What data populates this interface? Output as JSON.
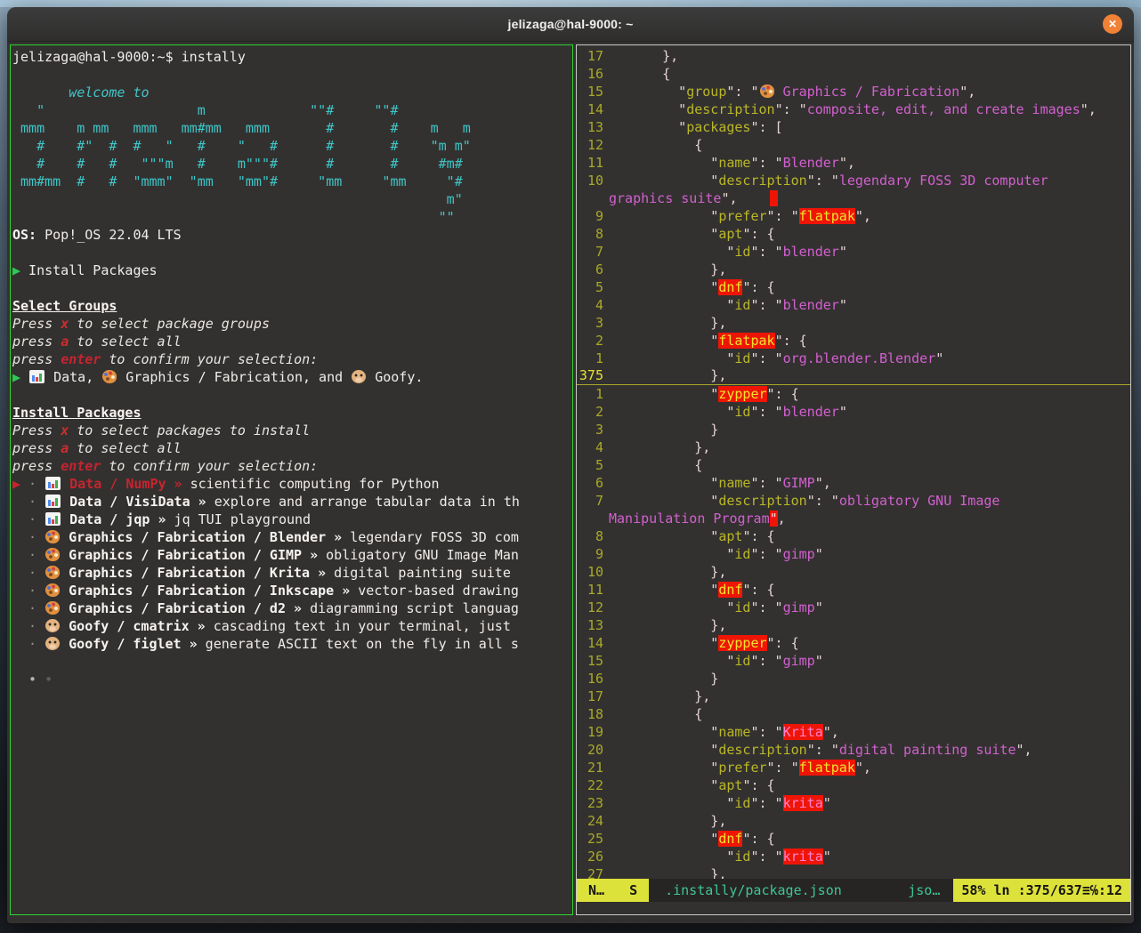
{
  "window": {
    "title": "jelizaga@hal-9000: ~",
    "close_label": "✕"
  },
  "accents": {
    "focused_pane_border": "#2fd32f",
    "unfocused_pane_border": "#c9c9c9",
    "search_highlight_bg": "#ee1507",
    "close_button": "#f08137",
    "statusline_yellow": "#dde23a",
    "terminal_bg": "#333130",
    "ascii_cyan": "#3fc6c8"
  },
  "left_pane": {
    "lines": [
      [
        [
          "w",
          "jelizaga@hal-9000:~$ instally"
        ]
      ],
      [],
      [
        [
          "ci",
          "       welcome to"
        ]
      ],
      [
        [
          "c",
          "   \"                   m             \"\"#     \"\"#"
        ]
      ],
      [
        [
          "c",
          " mmm    m mm   mmm   mm#mm   mmm       #       #    m   m"
        ]
      ],
      [
        [
          "c",
          "   #    #\"  #  #   \"   #    \"   #      #       #    \"m m\""
        ]
      ],
      [
        [
          "c",
          "   #    #   #   \"\"\"m   #    m\"\"\"#      #       #     #m#"
        ]
      ],
      [
        [
          "c",
          " mm#mm  #   #  \"mmm\"  \"mm   \"mm\"#     \"mm     \"mm     \"#"
        ]
      ],
      [
        [
          "c",
          "                                                      m\""
        ]
      ],
      [
        [
          "c",
          "                                                     \"\""
        ]
      ],
      [
        [
          "b",
          "OS:"
        ],
        [
          "w",
          " Pop!_OS 22.04 LTS"
        ]
      ],
      [],
      [
        [
          "g",
          "▶"
        ],
        [
          "w",
          " Install Packages"
        ]
      ],
      [],
      [
        [
          "bu",
          "Select Groups"
        ]
      ],
      [
        [
          "i",
          "Press "
        ],
        [
          "x",
          "x"
        ],
        [
          "i",
          " to select package groups"
        ]
      ],
      [
        [
          "i",
          "press "
        ],
        [
          "x",
          "a"
        ],
        [
          "i",
          " to select all"
        ]
      ],
      [
        [
          "i",
          "press "
        ],
        [
          "eb",
          "enter"
        ],
        [
          "i",
          " to confirm your selection:"
        ]
      ],
      [
        [
          "g",
          "▶"
        ],
        [
          "w",
          " "
        ],
        [
          "icoData",
          ""
        ],
        [
          "w",
          " Data, "
        ],
        [
          "icoGfx",
          ""
        ],
        [
          "w",
          " Graphics / Fabrication, and "
        ],
        [
          "icoGoofy",
          ""
        ],
        [
          "w",
          " Goofy."
        ]
      ],
      [],
      [
        [
          "bu",
          "Install Packages"
        ]
      ],
      [
        [
          "i",
          "Press "
        ],
        [
          "x",
          "x"
        ],
        [
          "i",
          " to select packages to install"
        ]
      ],
      [
        [
          "i",
          "press "
        ],
        [
          "x",
          "a"
        ],
        [
          "i",
          " to select all"
        ]
      ],
      [
        [
          "i",
          "press "
        ],
        [
          "eb",
          "enter"
        ],
        [
          "i",
          " to confirm your selection:"
        ]
      ],
      [
        [
          "nr",
          "▶"
        ],
        [
          "dot",
          " · "
        ],
        [
          "icoData",
          ""
        ],
        [
          "nr",
          " Data / NumPy »"
        ],
        [
          "w",
          " scientific computing for Python"
        ]
      ],
      [
        [
          "dot",
          "  · "
        ],
        [
          "icoData",
          ""
        ],
        [
          "b",
          " Data / VisiData »"
        ],
        [
          "w",
          " explore and arrange tabular data in th"
        ]
      ],
      [
        [
          "dot",
          "  · "
        ],
        [
          "icoData",
          ""
        ],
        [
          "b",
          " Data / jqp »"
        ],
        [
          "w",
          " jq TUI playground"
        ]
      ],
      [
        [
          "dot",
          "  · "
        ],
        [
          "icoGfx",
          ""
        ],
        [
          "b",
          " Graphics / Fabrication / Blender »"
        ],
        [
          "w",
          " legendary FOSS 3D com"
        ]
      ],
      [
        [
          "dot",
          "  · "
        ],
        [
          "icoGfx",
          ""
        ],
        [
          "b",
          " Graphics / Fabrication / GIMP »"
        ],
        [
          "w",
          " obligatory GNU Image Man"
        ]
      ],
      [
        [
          "dot",
          "  · "
        ],
        [
          "icoGfx",
          ""
        ],
        [
          "b",
          " Graphics / Fabrication / Krita »"
        ],
        [
          "w",
          " digital painting suite"
        ]
      ],
      [
        [
          "dot",
          "  · "
        ],
        [
          "icoGfx",
          ""
        ],
        [
          "b",
          " Graphics / Fabrication / Inkscape »"
        ],
        [
          "w",
          " vector-based drawing"
        ]
      ],
      [
        [
          "dot",
          "  · "
        ],
        [
          "icoGfx",
          ""
        ],
        [
          "b",
          " Graphics / Fabrication / d2 »"
        ],
        [
          "w",
          " diagramming script languag"
        ]
      ],
      [
        [
          "dot",
          "  · "
        ],
        [
          "icoGoofy",
          ""
        ],
        [
          "b",
          " Goofy / cmatrix »"
        ],
        [
          "w",
          " cascading text in your terminal, just"
        ]
      ],
      [
        [
          "dot",
          "  · "
        ],
        [
          "icoGoofy",
          ""
        ],
        [
          "b",
          " Goofy / figlet »"
        ],
        [
          "w",
          " generate ASCII text on the fly in all s"
        ]
      ],
      [],
      [
        [
          "pga",
          "  •"
        ],
        [
          "pgb",
          " •"
        ]
      ]
    ]
  },
  "right_pane": {
    "lines": [
      {
        "n": "17",
        "seg": [
          [
            "p",
            "    },"
          ]
        ]
      },
      {
        "n": "16",
        "seg": [
          [
            "p",
            "    {"
          ]
        ]
      },
      {
        "n": "15",
        "seg": [
          [
            "p",
            "      \""
          ],
          [
            "k",
            "group"
          ],
          [
            "p",
            "\": \""
          ],
          [
            "icoGfx",
            ""
          ],
          [
            "v",
            " Graphics / Fabrication"
          ],
          [
            "p",
            "\","
          ]
        ]
      },
      {
        "n": "14",
        "seg": [
          [
            "p",
            "      \""
          ],
          [
            "k",
            "description"
          ],
          [
            "p",
            "\": \""
          ],
          [
            "v",
            "composite, edit, and create images"
          ],
          [
            "p",
            "\","
          ]
        ]
      },
      {
        "n": "13",
        "seg": [
          [
            "p",
            "      \""
          ],
          [
            "k",
            "packages"
          ],
          [
            "p",
            "\": ["
          ]
        ]
      },
      {
        "n": "12",
        "seg": [
          [
            "p",
            "        {"
          ]
        ]
      },
      {
        "n": "11",
        "seg": [
          [
            "p",
            "          \""
          ],
          [
            "k",
            "name"
          ],
          [
            "p",
            "\": \""
          ],
          [
            "v",
            "Blender"
          ],
          [
            "p",
            "\","
          ]
        ]
      },
      {
        "n": "10",
        "seg": [
          [
            "p",
            "          \""
          ],
          [
            "k",
            "description"
          ],
          [
            "p",
            "\": \""
          ],
          [
            "v",
            "legendary FOSS 3D computer"
          ]
        ]
      },
      {
        "n": "",
        "wrap": true,
        "seg": [
          [
            "v",
            "graphics suite"
          ],
          [
            "p",
            "\",    "
          ],
          [
            "blk",
            " "
          ]
        ]
      },
      {
        "n": "9",
        "seg": [
          [
            "p",
            "          \""
          ],
          [
            "k",
            "prefer"
          ],
          [
            "p",
            "\": \""
          ],
          [
            "hy",
            "flatpak"
          ],
          [
            "p",
            "\","
          ]
        ]
      },
      {
        "n": "8",
        "seg": [
          [
            "p",
            "          \""
          ],
          [
            "k",
            "apt"
          ],
          [
            "p",
            "\": {"
          ]
        ]
      },
      {
        "n": "7",
        "seg": [
          [
            "p",
            "            \""
          ],
          [
            "k",
            "id"
          ],
          [
            "p",
            "\": \""
          ],
          [
            "v",
            "blender"
          ],
          [
            "p",
            "\""
          ]
        ]
      },
      {
        "n": "6",
        "seg": [
          [
            "p",
            "          },"
          ]
        ]
      },
      {
        "n": "5",
        "seg": [
          [
            "p",
            "          \""
          ],
          [
            "hy",
            "dnf"
          ],
          [
            "p",
            "\": {"
          ]
        ]
      },
      {
        "n": "4",
        "seg": [
          [
            "p",
            "            \""
          ],
          [
            "k",
            "id"
          ],
          [
            "p",
            "\": \""
          ],
          [
            "v",
            "blender"
          ],
          [
            "p",
            "\""
          ]
        ]
      },
      {
        "n": "3",
        "seg": [
          [
            "p",
            "          },"
          ]
        ]
      },
      {
        "n": "2",
        "seg": [
          [
            "p",
            "          \""
          ],
          [
            "hy",
            "flatpak"
          ],
          [
            "p",
            "\": {"
          ]
        ]
      },
      {
        "n": "1",
        "seg": [
          [
            "p",
            "            \""
          ],
          [
            "k",
            "id"
          ],
          [
            "p",
            "\": \""
          ],
          [
            "v",
            "org.blender.Blender"
          ],
          [
            "p",
            "\""
          ]
        ]
      },
      {
        "n": "375",
        "cursor": true,
        "seg": [
          [
            "p",
            "          },"
          ]
        ]
      },
      {
        "n": "1",
        "seg": [
          [
            "p",
            "          \""
          ],
          [
            "hy",
            "zypper"
          ],
          [
            "p",
            "\": {"
          ]
        ]
      },
      {
        "n": "2",
        "seg": [
          [
            "p",
            "            \""
          ],
          [
            "k",
            "id"
          ],
          [
            "p",
            "\": \""
          ],
          [
            "v",
            "blender"
          ],
          [
            "p",
            "\""
          ]
        ]
      },
      {
        "n": "3",
        "seg": [
          [
            "p",
            "          }"
          ]
        ]
      },
      {
        "n": "4",
        "seg": [
          [
            "p",
            "        },"
          ]
        ]
      },
      {
        "n": "5",
        "seg": [
          [
            "p",
            "        {"
          ]
        ]
      },
      {
        "n": "6",
        "seg": [
          [
            "p",
            "          \""
          ],
          [
            "k",
            "name"
          ],
          [
            "p",
            "\": \""
          ],
          [
            "v",
            "GIMP"
          ],
          [
            "p",
            "\","
          ]
        ]
      },
      {
        "n": "7",
        "seg": [
          [
            "p",
            "          \""
          ],
          [
            "k",
            "description"
          ],
          [
            "p",
            "\": \""
          ],
          [
            "v",
            "obligatory GNU Image"
          ]
        ]
      },
      {
        "n": "",
        "wrap": true,
        "seg": [
          [
            "v",
            "Manipulation Program"
          ],
          [
            "hq",
            "\""
          ],
          [
            "p",
            ","
          ]
        ]
      },
      {
        "n": "8",
        "seg": [
          [
            "p",
            "          \""
          ],
          [
            "k",
            "apt"
          ],
          [
            "p",
            "\": {"
          ]
        ]
      },
      {
        "n": "9",
        "seg": [
          [
            "p",
            "            \""
          ],
          [
            "k",
            "id"
          ],
          [
            "p",
            "\": \""
          ],
          [
            "v",
            "gimp"
          ],
          [
            "p",
            "\""
          ]
        ]
      },
      {
        "n": "10",
        "seg": [
          [
            "p",
            "          },"
          ]
        ]
      },
      {
        "n": "11",
        "seg": [
          [
            "p",
            "          \""
          ],
          [
            "hy",
            "dnf"
          ],
          [
            "p",
            "\": {"
          ]
        ]
      },
      {
        "n": "12",
        "seg": [
          [
            "p",
            "            \""
          ],
          [
            "k",
            "id"
          ],
          [
            "p",
            "\": \""
          ],
          [
            "v",
            "gimp"
          ],
          [
            "p",
            "\""
          ]
        ]
      },
      {
        "n": "13",
        "seg": [
          [
            "p",
            "          },"
          ]
        ]
      },
      {
        "n": "14",
        "seg": [
          [
            "p",
            "          \""
          ],
          [
            "hy",
            "zypper"
          ],
          [
            "p",
            "\": {"
          ]
        ]
      },
      {
        "n": "15",
        "seg": [
          [
            "p",
            "            \""
          ],
          [
            "k",
            "id"
          ],
          [
            "p",
            "\": \""
          ],
          [
            "v",
            "gimp"
          ],
          [
            "p",
            "\""
          ]
        ]
      },
      {
        "n": "16",
        "seg": [
          [
            "p",
            "          }"
          ]
        ]
      },
      {
        "n": "17",
        "seg": [
          [
            "p",
            "        },"
          ]
        ]
      },
      {
        "n": "18",
        "seg": [
          [
            "p",
            "        {"
          ]
        ]
      },
      {
        "n": "19",
        "seg": [
          [
            "p",
            "          \""
          ],
          [
            "k",
            "name"
          ],
          [
            "p",
            "\": \""
          ],
          [
            "hp",
            "Krita"
          ],
          [
            "p",
            "\","
          ]
        ]
      },
      {
        "n": "20",
        "seg": [
          [
            "p",
            "          \""
          ],
          [
            "k",
            "description"
          ],
          [
            "p",
            "\": \""
          ],
          [
            "v",
            "digital painting suite"
          ],
          [
            "p",
            "\","
          ]
        ]
      },
      {
        "n": "21",
        "seg": [
          [
            "p",
            "          \""
          ],
          [
            "k",
            "prefer"
          ],
          [
            "p",
            "\": \""
          ],
          [
            "hy",
            "flatpak"
          ],
          [
            "p",
            "\","
          ]
        ]
      },
      {
        "n": "22",
        "seg": [
          [
            "p",
            "          \""
          ],
          [
            "k",
            "apt"
          ],
          [
            "p",
            "\": {"
          ]
        ]
      },
      {
        "n": "23",
        "seg": [
          [
            "p",
            "            \""
          ],
          [
            "k",
            "id"
          ],
          [
            "p",
            "\": \""
          ],
          [
            "hp",
            "krita"
          ],
          [
            "p",
            "\""
          ]
        ]
      },
      {
        "n": "24",
        "seg": [
          [
            "p",
            "          },"
          ]
        ]
      },
      {
        "n": "25",
        "seg": [
          [
            "p",
            "          \""
          ],
          [
            "hy",
            "dnf"
          ],
          [
            "p",
            "\": {"
          ]
        ]
      },
      {
        "n": "26",
        "seg": [
          [
            "p",
            "            \""
          ],
          [
            "k",
            "id"
          ],
          [
            "p",
            "\": \""
          ],
          [
            "hp",
            "krita"
          ],
          [
            "p",
            "\""
          ]
        ]
      },
      {
        "n": "27",
        "seg": [
          [
            "p",
            "          },"
          ]
        ]
      }
    ],
    "statusline": {
      "mode": "N…",
      "flag": "S",
      "file": ".instally/package.json",
      "filetype": "jso…",
      "position": "58% ln :375/637≡℅:12"
    }
  }
}
